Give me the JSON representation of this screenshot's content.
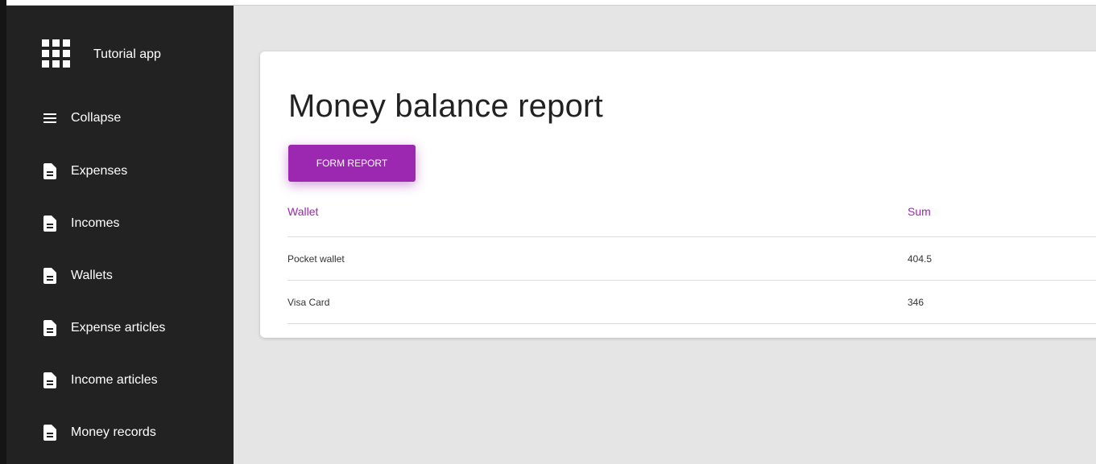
{
  "app": {
    "title": "Tutorial app"
  },
  "sidebar": {
    "items": [
      {
        "label": "Collapse",
        "icon": "hamburger-icon"
      },
      {
        "label": "Expenses",
        "icon": "document-icon"
      },
      {
        "label": "Incomes",
        "icon": "document-icon"
      },
      {
        "label": "Wallets",
        "icon": "document-icon"
      },
      {
        "label": "Expense articles",
        "icon": "document-icon"
      },
      {
        "label": "Income articles",
        "icon": "document-icon"
      },
      {
        "label": "Money records",
        "icon": "document-icon"
      }
    ]
  },
  "main": {
    "title": "Money balance report",
    "form_button_label": "FORM REPORT",
    "table": {
      "headers": [
        "Wallet",
        "Sum"
      ],
      "rows": [
        [
          "Pocket wallet",
          "404.5"
        ],
        [
          "Visa Card",
          "346"
        ]
      ]
    }
  },
  "colors": {
    "accent": "#9c27b0",
    "sidebar_bg": "#222222",
    "page_bg": "#e5e5e5"
  }
}
